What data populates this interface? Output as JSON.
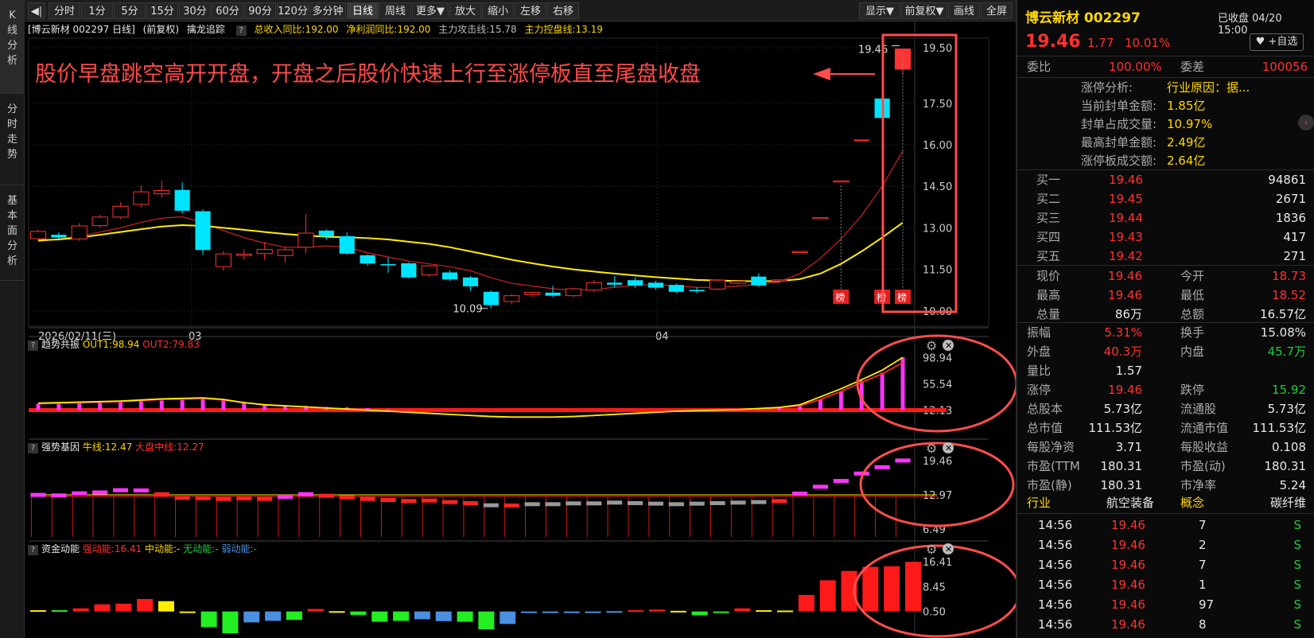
{
  "toolbar": {
    "items": [
      "分时",
      "1分",
      "5分",
      "15分",
      "30分",
      "60分",
      "90分",
      "120分",
      "多分钟",
      "日线",
      "周线",
      "更多▼",
      "放大",
      "缩小",
      "左移",
      "右移"
    ],
    "active": "日线",
    "right_items": [
      "显示▼",
      "前复权▼",
      "画线",
      "全屏"
    ],
    "back_icon": "◀|"
  },
  "left_tabs": [
    {
      "label": "K线分析"
    },
    {
      "label": "分时走势"
    },
    {
      "label": "基本面分析"
    }
  ],
  "title_bar": {
    "stock": "[博云新材 002297 日线]",
    "adjust": "(前复权)",
    "indicator": "擒龙追踪",
    "help": "?",
    "rev_yoy": "总收入同比:192.00",
    "profit_yoy": "净利润同比:192.00",
    "attack": "主力攻击线:15.78",
    "control": "主力控盘线:13.19"
  },
  "annotation": "股价早盘跳空高开开盘，开盘之后股价快速上行至涨停板直至尾盘收盘",
  "main_chart": {
    "price_axis": [
      "19.50",
      "17.50",
      "16.00",
      "14.50",
      "13.00",
      "11.50",
      "10.00"
    ],
    "price_ticks": [
      19.5,
      17.5,
      16.0,
      14.5,
      13.0,
      11.5,
      10.0
    ],
    "low_label": "10.09",
    "high_label": "19.46",
    "date_labels": [
      "2026/02/11(三)",
      "03",
      "04"
    ],
    "bang_label": "榜",
    "candles": [
      [
        12.61,
        12.87,
        12.56,
        12.93
      ],
      [
        12.75,
        12.65,
        12.59,
        12.84
      ],
      [
        12.6,
        13.07,
        12.53,
        13.17
      ],
      [
        13.08,
        13.39,
        13.01,
        13.47
      ],
      [
        13.39,
        13.78,
        13.32,
        13.92
      ],
      [
        13.85,
        14.3,
        13.73,
        14.53
      ],
      [
        14.23,
        14.35,
        14.09,
        14.71
      ],
      [
        14.37,
        13.62,
        13.51,
        14.65
      ],
      [
        13.6,
        12.2,
        12.03,
        13.67
      ],
      [
        11.6,
        12.06,
        11.45,
        12.15
      ],
      [
        12.0,
        12.05,
        11.85,
        12.23
      ],
      [
        12.07,
        12.22,
        11.85,
        12.49
      ],
      [
        12.0,
        12.21,
        11.75,
        12.31
      ],
      [
        12.3,
        12.81,
        12.08,
        13.5
      ],
      [
        12.9,
        12.69,
        12.57,
        12.95
      ],
      [
        12.7,
        12.07,
        12.03,
        12.84
      ],
      [
        12.01,
        11.71,
        11.62,
        12.05
      ],
      [
        11.69,
        11.67,
        11.38,
        11.93
      ],
      [
        11.72,
        11.21,
        11.18,
        11.76
      ],
      [
        11.3,
        11.63,
        11.22,
        11.66
      ],
      [
        11.39,
        11.14,
        11.08,
        11.47
      ],
      [
        11.21,
        10.89,
        10.73,
        11.26
      ],
      [
        10.69,
        10.21,
        10.09,
        10.74
      ],
      [
        10.34,
        10.55,
        10.24,
        10.6
      ],
      [
        10.59,
        10.67,
        10.5,
        10.7
      ],
      [
        10.66,
        10.55,
        10.5,
        10.91
      ],
      [
        10.55,
        10.8,
        10.5,
        10.83
      ],
      [
        10.75,
        11.02,
        10.68,
        11.11
      ],
      [
        11.02,
        10.95,
        10.85,
        11.26
      ],
      [
        11.11,
        10.92,
        10.82,
        11.22
      ],
      [
        11.02,
        10.84,
        10.76,
        11.09
      ],
      [
        10.94,
        10.69,
        10.64,
        10.98
      ],
      [
        10.76,
        10.71,
        10.63,
        10.86
      ],
      [
        10.79,
        11.11,
        10.74,
        11.14
      ],
      [
        11.0,
        11.07,
        10.95,
        11.12
      ],
      [
        11.24,
        10.92,
        10.87,
        11.36
      ],
      [
        11.12,
        11.12,
        11.0,
        11.12
      ],
      [
        12.15,
        12.15,
        12.15,
        12.15
      ],
      [
        13.37,
        13.37,
        13.37,
        13.37
      ],
      [
        14.7,
        14.7,
        14.7,
        14.7
      ],
      [
        16.16,
        16.16,
        16.16,
        16.16
      ],
      [
        17.67,
        16.97,
        16.97,
        17.67
      ],
      [
        18.73,
        19.46,
        18.52,
        19.46
      ]
    ],
    "ma_attack": [
      12.5,
      12.6,
      12.7,
      12.85,
      13.0,
      13.2,
      13.35,
      13.4,
      13.2,
      12.9,
      12.65,
      12.45,
      12.3,
      12.3,
      12.35,
      12.3,
      12.1,
      11.95,
      11.8,
      11.7,
      11.6,
      11.45,
      11.2,
      11.0,
      10.9,
      10.8,
      10.75,
      10.78,
      10.85,
      10.92,
      10.95,
      10.9,
      10.85,
      10.85,
      10.9,
      10.95,
      11.05,
      11.35,
      11.9,
      12.6,
      13.45,
      14.5,
      15.78
    ],
    "ma_control": [
      12.55,
      12.58,
      12.65,
      12.75,
      12.85,
      12.95,
      13.05,
      13.1,
      13.07,
      13.0,
      12.93,
      12.85,
      12.78,
      12.72,
      12.68,
      12.66,
      12.63,
      12.58,
      12.5,
      12.42,
      12.3,
      12.15,
      12.0,
      11.85,
      11.72,
      11.6,
      11.5,
      11.42,
      11.35,
      11.28,
      11.22,
      11.17,
      11.12,
      11.1,
      11.08,
      11.07,
      11.08,
      11.15,
      11.35,
      11.7,
      12.15,
      12.65,
      13.19
    ]
  },
  "panel1": {
    "title": "趋势共振",
    "out1": "OUT1:98.94",
    "out2": "OUT2:79.83",
    "axis": [
      "98.94",
      "55.54",
      "12.13"
    ],
    "axis_vals": [
      98.94,
      55.54,
      12.13
    ],
    "bars": [
      12,
      13,
      14,
      15,
      16,
      17,
      18,
      19,
      21,
      19,
      14,
      11,
      9,
      8,
      6,
      5,
      4,
      2,
      1,
      0,
      0,
      0,
      -1,
      -1,
      -1,
      0,
      0,
      0,
      0,
      0,
      0,
      0,
      0,
      1,
      1,
      2,
      5,
      10,
      20,
      35,
      55,
      70,
      98.94
    ],
    "out1_line": [
      13,
      14,
      15,
      16,
      17,
      19,
      21,
      22,
      23,
      20,
      14,
      10,
      8,
      6,
      4,
      2,
      0,
      -2,
      -4,
      -6,
      -8,
      -10,
      -12,
      -13,
      -13,
      -13,
      -12,
      -10,
      -8,
      -6,
      -4,
      -2,
      -1,
      0,
      1,
      3,
      5,
      10,
      25,
      40,
      57,
      75,
      98.94
    ],
    "out2_line": [
      12,
      13,
      14,
      15,
      16,
      18,
      20,
      21,
      22,
      19,
      14,
      10,
      8,
      6,
      4,
      2,
      0,
      -2,
      -4,
      -6,
      -8,
      -10,
      -12,
      -13,
      -13,
      -13,
      -12,
      -10,
      -8,
      -6,
      -4,
      -2,
      -1,
      0,
      1,
      3,
      5,
      8,
      20,
      35,
      52,
      68,
      89
    ]
  },
  "panel2": {
    "title": "强势基因",
    "bull": "牛线:12.47",
    "market": "大盘中线:12.27",
    "axis": [
      "19.46",
      "12.97",
      "6.49"
    ],
    "axis_vals": [
      19.46,
      12.97,
      6.49
    ],
    "markers": [
      12.96,
      12.85,
      13.26,
      13.42,
      13.85,
      13.8,
      13.1,
      12.4,
      12.35,
      12.2,
      12.3,
      12.2,
      12.6,
      13.1,
      12.8,
      12.5,
      12.2,
      12.0,
      11.8,
      11.9,
      11.6,
      11.4,
      11.0,
      10.95,
      11.2,
      11.2,
      11.35,
      11.35,
      11.5,
      11.4,
      11.3,
      11.2,
      11.3,
      11.4,
      11.5,
      11.6,
      11.8,
      13.2,
      14.5,
      15.6,
      17.0,
      18.2,
      19.46
    ],
    "marker_colors": [
      "m",
      "m",
      "m",
      "m",
      "m",
      "m",
      "r",
      "r",
      "r",
      "r",
      "r",
      "r",
      "m",
      "m",
      "r",
      "r",
      "r",
      "r",
      "r",
      "r",
      "r",
      "r",
      "g",
      "r",
      "g",
      "g",
      "g",
      "g",
      "g",
      "g",
      "g",
      "g",
      "g",
      "g",
      "g",
      "g",
      "r",
      "m",
      "m",
      "m",
      "m",
      "m",
      "m"
    ],
    "line_val": 12.97
  },
  "panel3": {
    "title": "资金动能",
    "strong": "强动能:16.41",
    "mid": "中动能:-",
    "none": "无动能:-",
    "weak": "弱动能:-",
    "axis": [
      "16.41",
      "8.45",
      "0.50"
    ],
    "axis_vals": [
      16.41,
      8.45,
      0.5
    ],
    "bars": [
      0.9,
      0.9,
      1.5,
      2.8,
      3.0,
      4.5,
      3.8,
      0.5,
      -4.5,
      -6.5,
      -3.0,
      -2.5,
      -2.2,
      1.3,
      0.6,
      -0.6,
      -2.8,
      -2.5,
      -2.0,
      -2.6,
      -2.8,
      -5.2,
      -3.5,
      0.4,
      0.5,
      0.3,
      0.2,
      0.6,
      0.9,
      1.1,
      0.7,
      -0.7,
      0.3,
      1.5,
      0.9,
      0.8,
      5.8,
      10.5,
      13.5,
      14.8,
      15.0,
      16.41
    ],
    "colors": [
      "y",
      "g",
      "r",
      "r",
      "r",
      "r",
      "y",
      "y",
      "g",
      "g",
      "b",
      "b",
      "g",
      "r",
      "y",
      "g",
      "g",
      "g",
      "b",
      "b",
      "g",
      "g",
      "b",
      "b",
      "b",
      "b",
      "b",
      "b",
      "r",
      "r",
      "y",
      "g",
      "g",
      "r",
      "y",
      "y",
      "r",
      "r",
      "r",
      "r",
      "r",
      "r"
    ]
  },
  "quote": {
    "name": "博云新材 002297",
    "status": "已收盘 04/20 15:00",
    "price": "19.46",
    "change": "1.77",
    "pct": "10.01%",
    "fav": "+自选",
    "weibi_label": "委比",
    "weibi": "100.00%",
    "weicha_label": "委差",
    "weicha": "100056",
    "limit_analysis": [
      {
        "k": "涨停分析:",
        "v": "行业原因：据..."
      },
      {
        "k": "当前封单金额:",
        "v": "1.85亿"
      },
      {
        "k": "封单占成交量:",
        "v": "10.97%"
      },
      {
        "k": "最高封单金额:",
        "v": "2.49亿"
      },
      {
        "k": "涨停板成交额:",
        "v": "2.64亿"
      }
    ],
    "bids": [
      {
        "k": "买一",
        "p": "19.46",
        "v": "94861"
      },
      {
        "k": "买二",
        "p": "19.45",
        "v": "2671"
      },
      {
        "k": "买三",
        "p": "19.44",
        "v": "1836"
      },
      {
        "k": "买四",
        "p": "19.43",
        "v": "417"
      },
      {
        "k": "买五",
        "p": "19.42",
        "v": "271"
      }
    ],
    "stats": [
      [
        {
          "k": "现价",
          "v": "19.46",
          "c": "red"
        },
        {
          "k": "今开",
          "v": "18.73",
          "c": "red"
        }
      ],
      [
        {
          "k": "最高",
          "v": "19.46",
          "c": "red"
        },
        {
          "k": "最低",
          "v": "18.52",
          "c": "red"
        }
      ],
      [
        {
          "k": "总量",
          "v": "86万",
          "c": "white"
        },
        {
          "k": "总额",
          "v": "16.57亿",
          "c": "white"
        }
      ]
    ],
    "stats2": [
      [
        {
          "k": "振幅",
          "v": "5.31%",
          "c": "red"
        },
        {
          "k": "换手",
          "v": "15.08%",
          "c": "white"
        }
      ],
      [
        {
          "k": "外盘",
          "v": "40.3万",
          "c": "red"
        },
        {
          "k": "内盘",
          "v": "45.7万",
          "c": "green"
        }
      ],
      [
        {
          "k": "量比",
          "v": "1.57",
          "c": "white"
        },
        {
          "k": "",
          "v": "",
          "c": "white"
        }
      ],
      [
        {
          "k": "涨停",
          "v": "19.46",
          "c": "red"
        },
        {
          "k": "跌停",
          "v": "15.92",
          "c": "green"
        }
      ],
      [
        {
          "k": "总股本",
          "v": "5.73亿",
          "c": "white"
        },
        {
          "k": "流通股",
          "v": "5.73亿",
          "c": "white"
        }
      ],
      [
        {
          "k": "总市值",
          "v": "111.53亿",
          "c": "white"
        },
        {
          "k": "流通市值",
          "v": "111.53亿",
          "c": "white"
        }
      ],
      [
        {
          "k": "每股净资",
          "v": "3.71",
          "c": "white"
        },
        {
          "k": "每股收益",
          "v": "0.108",
          "c": "white"
        }
      ],
      [
        {
          "k": "市盈(TTM",
          "v": "180.31",
          "c": "white"
        },
        {
          "k": "市盈(动)",
          "v": "180.31",
          "c": "white"
        }
      ],
      [
        {
          "k": "市盈(静)",
          "v": "180.31",
          "c": "white"
        },
        {
          "k": "市净率",
          "v": "5.24",
          "c": "white"
        }
      ]
    ],
    "industry_label": "行业",
    "industry": "航空装备",
    "concept_label": "概念",
    "concept": "碳纤维",
    "ticks": [
      {
        "t": "14:56",
        "p": "19.46",
        "v": "7",
        "s": "S"
      },
      {
        "t": "14:56",
        "p": "19.46",
        "v": "2",
        "s": "S"
      },
      {
        "t": "14:56",
        "p": "19.46",
        "v": "7",
        "s": "S"
      },
      {
        "t": "14:56",
        "p": "19.46",
        "v": "1",
        "s": "S"
      },
      {
        "t": "14:56",
        "p": "19.46",
        "v": "97",
        "s": "S"
      },
      {
        "t": "14:56",
        "p": "19.46",
        "v": "8",
        "s": "S"
      }
    ]
  }
}
